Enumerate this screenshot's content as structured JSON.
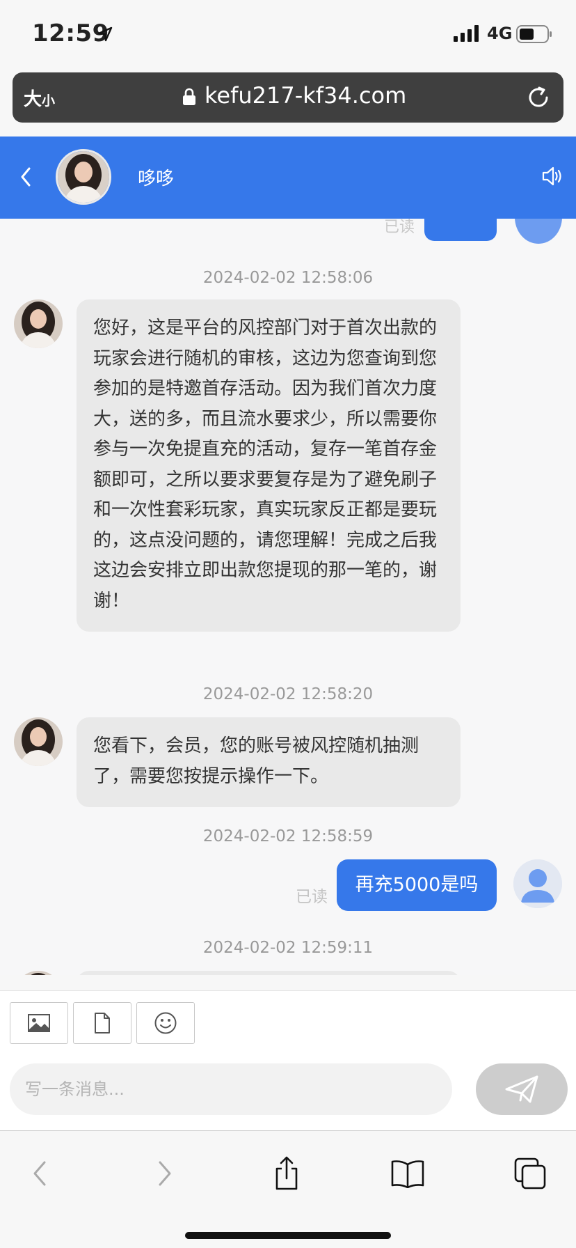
{
  "status_bar": {
    "time": "12:59",
    "network": "4G"
  },
  "browser": {
    "size_label_big": "大",
    "size_label_small": "小",
    "url": "kefu217-kf34.com"
  },
  "chat_header": {
    "name": "哆哆"
  },
  "messages": {
    "stub_read_label": "已读",
    "items": [
      {
        "timestamp": "2024-02-02 12:58:06",
        "sender": "agent",
        "text": "您好，这是平台的风控部门对于首次出款的玩家会进行随机的审核，这边为您查询到您参加的是特邀首存活动。因为我们首次力度大，送的多，而且流水要求少，所以需要你参与一次免提直充的活动，复存一笔首存金额即可，之所以要求要复存是为了避免刷子和一次性套彩玩家，真实玩家反正都是要玩的，这点没问题的，请您理解！完成之后我这边会安排立即出款您提现的那一笔的，谢谢！"
      },
      {
        "timestamp": "2024-02-02 12:58:20",
        "sender": "agent",
        "text": "您看下，会员，您的账号被风控随机抽测了，需要您按提示操作一下。"
      },
      {
        "timestamp": "2024-02-02 12:58:59",
        "sender": "user",
        "text": "再充5000是吗",
        "read_label": "已读"
      },
      {
        "timestamp": "2024-02-02 12:59:11",
        "sender": "agent",
        "text": ""
      }
    ]
  },
  "input": {
    "placeholder": "写一条消息..."
  },
  "icons": {
    "tools": [
      "image-icon",
      "file-icon",
      "emoji-icon"
    ],
    "send": "send-icon",
    "toolbar": [
      "back-arrow-icon",
      "forward-arrow-icon",
      "share-icon",
      "bookmarks-icon",
      "tabs-icon"
    ]
  },
  "colors": {
    "accent": "#3678ea",
    "agent_bubble": "#e9e9e9",
    "send_disabled": "#cdcdcd"
  }
}
